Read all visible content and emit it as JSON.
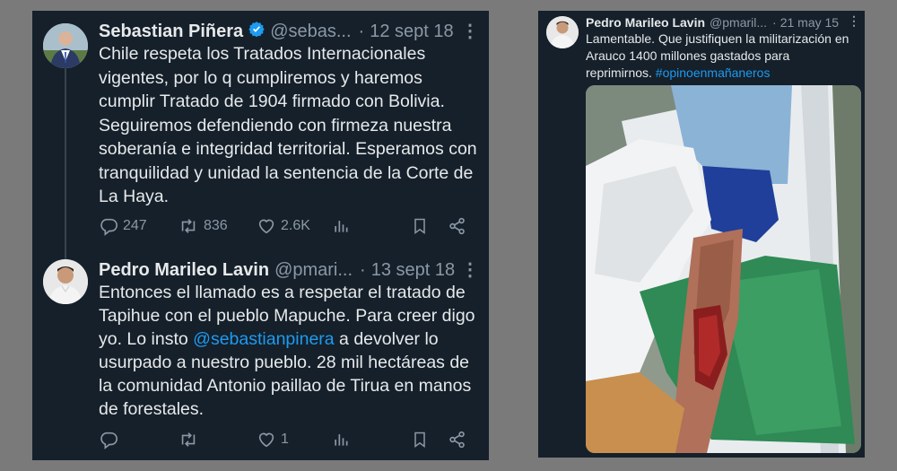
{
  "tweet1": {
    "author_name": "Sebastian Piñera",
    "handle": "@sebas...",
    "separator": "·",
    "date": "12 sept 18",
    "text": "Chile respeta los Tratados Internacionales vigentes, por lo q cumpliremos y haremos cumplir Tratado de 1904 firmado con Bolivia. Seguiremos defendiendo con firmeza nuestra soberanía e integridad territorial. Esperamos con tranquilidad y unidad la sentencia de la Corte de La Haya.",
    "replies": "247",
    "retweets": "836",
    "likes": "2.6K"
  },
  "tweet2": {
    "author_name": "Pedro Marileo Lavin",
    "handle": "@pmari...",
    "separator": "·",
    "date": "13 sept 18",
    "text_before_mention": "Entonces el llamado es a respetar el tratado de Tapihue con el pueblo Mapuche. Para creer digo yo. Lo insto ",
    "mention": "@sebastianpinera",
    "text_after_mention": " a devolver lo usurpado a nuestro pueblo. 28 mil hectáreas de la comunidad Antonio paillao de Tirua en manos de forestales.",
    "likes": "1"
  },
  "tweet3": {
    "author_name": "Pedro Marileo Lavin",
    "handle": "@pmaril...",
    "separator": "·",
    "date": "21 may 15",
    "text": "Lamentable. Que justifiquen la militarización en Arauco 1400 millones gastados para reprimirnos. ",
    "hashtag": "#opinoenmañaneros"
  },
  "icons": {
    "reply": "reply-icon",
    "retweet": "retweet-icon",
    "like": "heart-icon",
    "views": "analytics-icon",
    "bookmark": "bookmark-icon",
    "share": "share-icon",
    "more": "more-icon",
    "verified": "verified-badge-icon"
  },
  "colors": {
    "background": "#15202b",
    "text": "#e7e9ea",
    "secondary": "#8b98a5",
    "link": "#1d9bf0",
    "verified": "#1d9bf0"
  }
}
